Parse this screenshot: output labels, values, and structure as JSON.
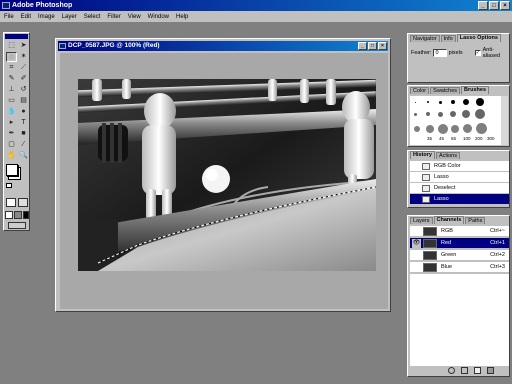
{
  "window": {
    "title": "Adobe Photoshop"
  },
  "menu": [
    "File",
    "Edit",
    "Image",
    "Layer",
    "Select",
    "Filter",
    "View",
    "Window",
    "Help"
  ],
  "document": {
    "title": "DCP_0587.JPG @ 100% (Red)"
  },
  "panels": {
    "navigator": {
      "tabs": [
        "Navigator",
        "Info",
        "Lasso Options"
      ],
      "feather_label": "Feather:",
      "feather_value": "0",
      "feather_unit": "pixels",
      "anti_alias_label": "Anti-aliased"
    },
    "brushes": {
      "tabs": [
        "Color",
        "Swatches",
        "Brushes"
      ],
      "sizes": [
        "35",
        "45",
        "65",
        "100",
        "200",
        "300"
      ]
    },
    "history": {
      "tabs": [
        "History",
        "Actions"
      ],
      "items": [
        "RGB Color",
        "Lasso",
        "Deselect",
        "Lasso"
      ]
    },
    "channels": {
      "tabs": [
        "Layers",
        "Channels",
        "Paths"
      ],
      "rows": [
        {
          "name": "RGB",
          "shortcut": "Ctrl+~"
        },
        {
          "name": "Red",
          "shortcut": "Ctrl+1"
        },
        {
          "name": "Green",
          "shortcut": "Ctrl+2"
        },
        {
          "name": "Blue",
          "shortcut": "Ctrl+3"
        }
      ]
    }
  }
}
